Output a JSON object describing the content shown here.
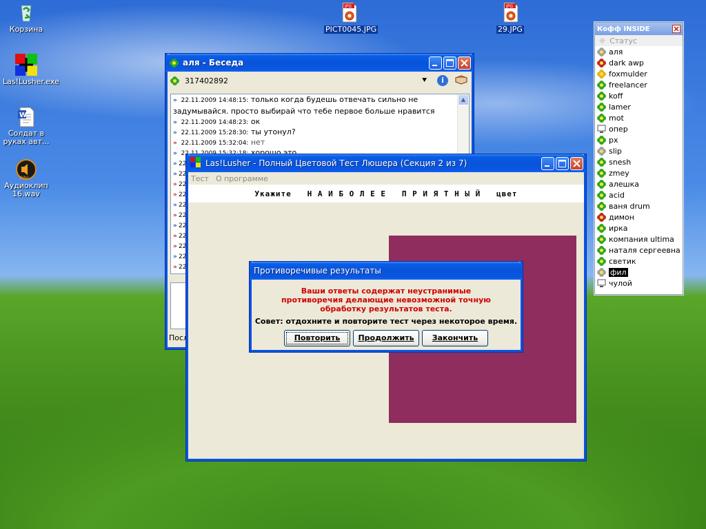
{
  "desktop": {
    "icons": [
      {
        "label": "Корзина"
      },
      {
        "label": "Las!Lusher.exe"
      },
      {
        "label": "Солдат в руках авт..."
      },
      {
        "label": "Аудиоклип 16.wav"
      },
      {
        "label": "PICT0045.JPG"
      },
      {
        "label": "29.JPG"
      }
    ],
    "jpg_badge": "JPG",
    "wav_badge": "WAV"
  },
  "chat": {
    "title": "аля - Беседа",
    "uin": "317402892",
    "messages": [
      {
        "dir": "in",
        "time": "22.11.2009 14:48:15:",
        "text": "только когда будешь отвечать сильно не задумывайся. просто выбирай что тебе первое больше нравится"
      },
      {
        "dir": "in",
        "time": "22.11.2009 14:48:23:",
        "text": "ок"
      },
      {
        "dir": "in",
        "time": "22.11.2009 15:28:30:",
        "text": "ты утонул?"
      },
      {
        "dir": "out",
        "time": "22.11.2009 15:32:04:",
        "text": "нет"
      },
      {
        "dir": "in",
        "time": "22.11.2009 15:32:18:",
        "text": "хорошо это"
      }
    ],
    "hidden_rows_prefix": "22",
    "status_text": "Посл"
  },
  "lusher": {
    "title": "Las!Lusher - Полный Цветовой Тест Люшера (Секция 2 из 7)",
    "menu": [
      "Тест",
      "О программе"
    ],
    "prompt": "Укажите   Н А И Б О Л Е Е   П Р И Я Т Н Ы Й   цвет",
    "swatch_color": "#8e2d5e"
  },
  "dialog": {
    "title": "Противоречивые результаты",
    "message": "Ваши ответы содержат неустранимые противоречия делающие невозможной точную обработку результатов теста.",
    "advice": "Совет: отдохните и повторите тест через некоторое время.",
    "buttons": {
      "retry": "Повторить",
      "continue": "Продолжить",
      "finish": "Закончить"
    }
  },
  "contacts": {
    "title": "Кофф INSIDE",
    "status_label": "Статус",
    "items": [
      {
        "name": "аля",
        "icon": "clover-grey"
      },
      {
        "name": "dark awp",
        "icon": "clover-red"
      },
      {
        "name": "foxmulder",
        "icon": "clover-yellow"
      },
      {
        "name": "freelancer",
        "icon": "clover-green"
      },
      {
        "name": "koff",
        "icon": "clover-green"
      },
      {
        "name": "lamer",
        "icon": "clover-green"
      },
      {
        "name": "mot",
        "icon": "clover-green"
      },
      {
        "name": "опер",
        "icon": "computer"
      },
      {
        "name": "px",
        "icon": "clover-green"
      },
      {
        "name": "slip",
        "icon": "clover-grey"
      },
      {
        "name": "snesh",
        "icon": "clover-green"
      },
      {
        "name": "zmey",
        "icon": "clover-green"
      },
      {
        "name": "алешка",
        "icon": "clover-green"
      },
      {
        "name": "acid",
        "icon": "clover-green"
      },
      {
        "name": "ваня drum",
        "icon": "clover-green"
      },
      {
        "name": "димон",
        "icon": "clover-red"
      },
      {
        "name": "ирка",
        "icon": "clover-green"
      },
      {
        "name": "компания ultima",
        "icon": "clover-green"
      },
      {
        "name": "наталя сергеевна",
        "icon": "clover-green"
      },
      {
        "name": "светик",
        "icon": "clover-green"
      },
      {
        "name": "фил",
        "icon": "clover-grey",
        "selected": true
      },
      {
        "name": "чулой",
        "icon": "computer"
      }
    ]
  }
}
